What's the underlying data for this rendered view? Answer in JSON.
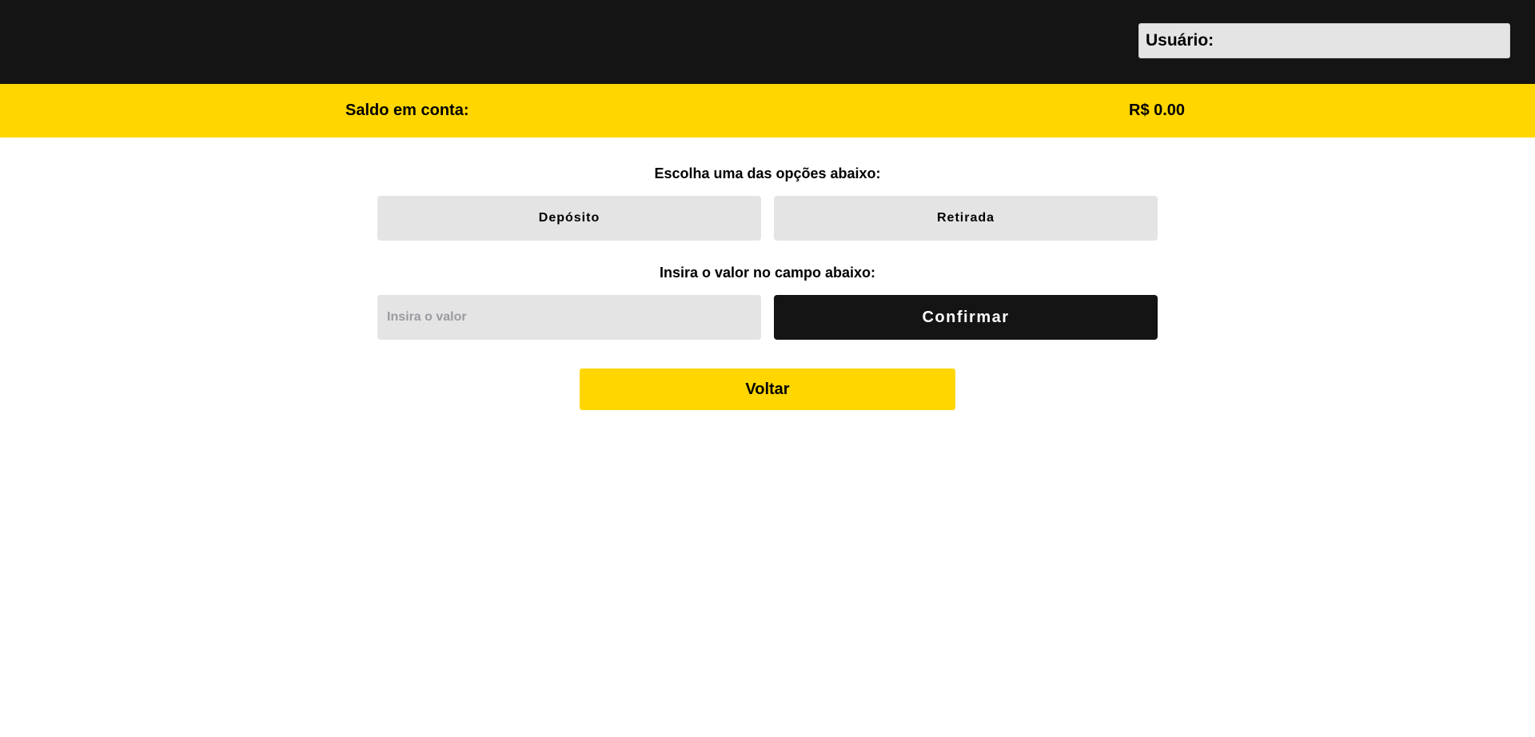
{
  "header": {
    "user_label": "Usuário:"
  },
  "balance": {
    "label": "Saldo em conta:",
    "value": "R$ 0.00"
  },
  "operations": {
    "prompt": "Escolha uma das opções abaixo:",
    "deposit_label": "Depósito",
    "withdraw_label": "Retirada"
  },
  "amount": {
    "prompt": "Insira o valor no campo abaixo:",
    "placeholder": "Insira o valor",
    "value": "",
    "confirm_label": "Confirmar"
  },
  "back_label": "Voltar",
  "colors": {
    "dark": "#141414",
    "accent_yellow": "#ffd600",
    "light_gray": "#e4e4e4",
    "placeholder_gray": "#9a9aa2"
  }
}
